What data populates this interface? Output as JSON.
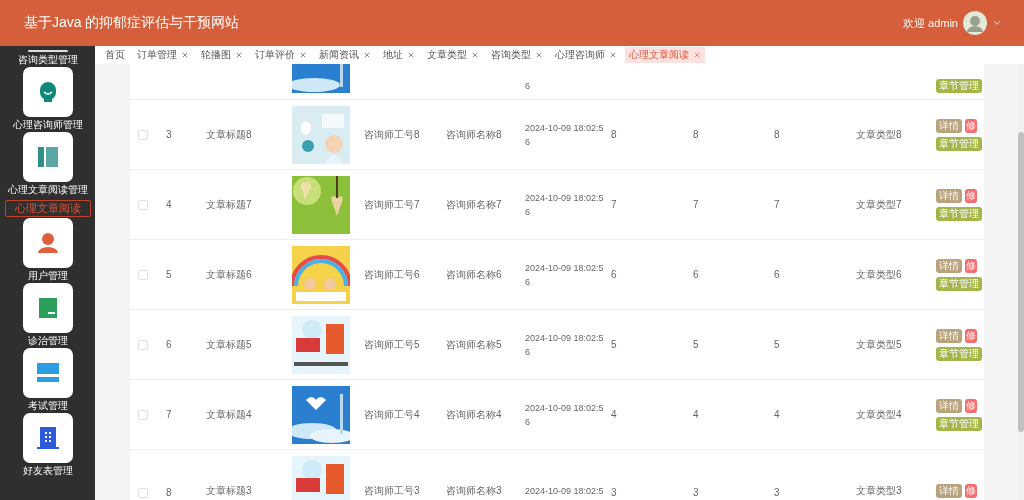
{
  "header": {
    "title": "基于Java 的抑郁症评估与干预网站",
    "welcome": "欢迎 admin"
  },
  "sidebar": {
    "items": [
      {
        "kind": "partial",
        "label": "咨询类型管理"
      },
      {
        "kind": "menu",
        "label": "心理咨询师管理"
      },
      {
        "kind": "menu",
        "label": "心理文章阅读管理",
        "children": [
          {
            "label": "心理文章阅读",
            "selected": true
          }
        ]
      },
      {
        "kind": "menu",
        "label": "用户管理"
      },
      {
        "kind": "menu",
        "label": "诊治管理"
      },
      {
        "kind": "menu",
        "label": "考试管理"
      },
      {
        "kind": "menu",
        "label": "好友表管理"
      }
    ]
  },
  "tabs": [
    {
      "label": "首页",
      "closable": false,
      "selected": false
    },
    {
      "label": "订单管理",
      "closable": true,
      "selected": false
    },
    {
      "label": "轮播图",
      "closable": true,
      "selected": false
    },
    {
      "label": "订单评价",
      "closable": true,
      "selected": false
    },
    {
      "label": "新闻资讯",
      "closable": true,
      "selected": false
    },
    {
      "label": "地址",
      "closable": true,
      "selected": false
    },
    {
      "label": "文章类型",
      "closable": true,
      "selected": false
    },
    {
      "label": "咨询类型",
      "closable": true,
      "selected": false
    },
    {
      "label": "心理咨询师",
      "closable": true,
      "selected": false
    },
    {
      "label": "心理文章阅读",
      "closable": true,
      "selected": true
    }
  ],
  "table": {
    "rows": [
      {
        "kind": "partial",
        "published": "6",
        "actions": [
          {
            "kind": "chapter",
            "label": "章节管理"
          }
        ]
      },
      {
        "kind": "full",
        "checked": false,
        "index": "3",
        "title": "文章标题8",
        "consultant_no": "咨询师工号8",
        "consultant_name": "咨询师名称8",
        "published": "2024-10-09 18:02:56",
        "column_7": "8",
        "column_8": "8",
        "column_9": "8",
        "article_type": "文章类型8",
        "actions": [
          {
            "kind": "detail",
            "label": "详情"
          },
          {
            "kind": "edit",
            "label": "修"
          },
          {
            "kind": "chapter",
            "label": "章节管理"
          }
        ]
      },
      {
        "kind": "full",
        "checked": false,
        "index": "4",
        "title": "文章标题7",
        "consultant_no": "咨询师工号7",
        "consultant_name": "咨询师名称7",
        "published": "2024-10-09 18:02:56",
        "column_7": "7",
        "column_8": "7",
        "column_9": "7",
        "article_type": "文章类型7",
        "actions": [
          {
            "kind": "detail",
            "label": "详情"
          },
          {
            "kind": "edit",
            "label": "修"
          },
          {
            "kind": "chapter",
            "label": "章节管理"
          }
        ]
      },
      {
        "kind": "full",
        "checked": false,
        "index": "5",
        "title": "文章标题6",
        "consultant_no": "咨询师工号6",
        "consultant_name": "咨询师名称6",
        "published": "2024-10-09 18:02:56",
        "column_7": "6",
        "column_8": "6",
        "column_9": "6",
        "article_type": "文章类型6",
        "actions": [
          {
            "kind": "detail",
            "label": "详情"
          },
          {
            "kind": "edit",
            "label": "修"
          },
          {
            "kind": "chapter",
            "label": "章节管理"
          }
        ]
      },
      {
        "kind": "full",
        "checked": false,
        "index": "6",
        "title": "文章标题5",
        "consultant_no": "咨询师工号5",
        "consultant_name": "咨询师名称5",
        "published": "2024-10-09 18:02:56",
        "column_7": "5",
        "column_8": "5",
        "column_9": "5",
        "article_type": "文章类型5",
        "actions": [
          {
            "kind": "detail",
            "label": "详情"
          },
          {
            "kind": "edit",
            "label": "修"
          },
          {
            "kind": "chapter",
            "label": "章节管理"
          }
        ]
      },
      {
        "kind": "full",
        "checked": false,
        "index": "7",
        "title": "文章标题4",
        "consultant_no": "咨询师工号4",
        "consultant_name": "咨询师名称4",
        "published": "2024-10-09 18:02:56",
        "column_7": "4",
        "column_8": "4",
        "column_9": "4",
        "article_type": "文章类型4",
        "actions": [
          {
            "kind": "detail",
            "label": "详情"
          },
          {
            "kind": "edit",
            "label": "修"
          },
          {
            "kind": "chapter",
            "label": "章节管理"
          }
        ]
      },
      {
        "kind": "cut",
        "checked": false,
        "index": "8",
        "title": "文章标题3",
        "consultant_no": "咨询师工号3",
        "consultant_name": "咨询师名称3",
        "published": "2024-10-09 18:02:5",
        "column_7": "3",
        "column_8": "3",
        "column_9": "3",
        "article_type": "文章类型3",
        "actions": [
          {
            "kind": "detail",
            "label": "详情"
          },
          {
            "kind": "edit",
            "label": "修"
          }
        ]
      }
    ]
  }
}
